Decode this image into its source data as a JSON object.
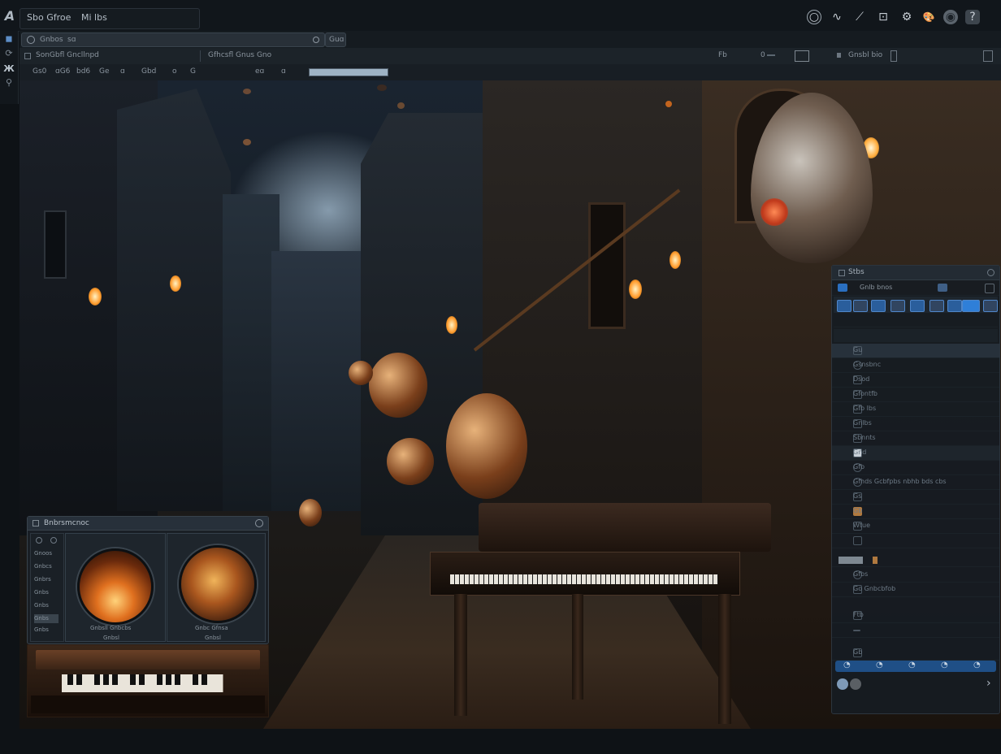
{
  "app": {
    "logo_glyph": "A",
    "title_left": "Sbo Gfroe",
    "title_right": "Mi lbs"
  },
  "topbar_icons": [
    "circle-icon",
    "wave-icon",
    "pen-icon",
    "frame-icon",
    "gear-icon",
    "palette-icon",
    "globe-icon",
    "help-icon"
  ],
  "topbar_glyphs": [
    "○",
    "∿",
    "⟋",
    "⊡",
    "⚙",
    "🎨",
    "◉",
    "?"
  ],
  "rail": {
    "glyphs": [
      "◼",
      "⟳",
      "Ж",
      "⚲"
    ]
  },
  "tabbar": {
    "tab_label": "Gnbos",
    "tab_badge": "sɑ",
    "tab2_label": "Guɑ"
  },
  "toolbar2": {
    "left_label": "SonGbfl Gncllnpd",
    "mid_label": "Gfhcsfl Gnus Gno",
    "right_a": "Fb",
    "right_b": "0",
    "right_c": "Gnsbl bio"
  },
  "toolbar3": {
    "items": [
      "Gs0",
      "ɑG6",
      "bd6",
      "Ge",
      "ɑ",
      "Gbd",
      "o",
      "G",
      "eɑ",
      "ɑ"
    ]
  },
  "right_panel": {
    "title": "Stbs",
    "search_label": "Gnlb bnos",
    "rows": [
      "Gu",
      "Gsnsbnc",
      "Dsod",
      "Gfontfb",
      "Gfb lbs",
      "Gnlbs",
      "Sbnnts",
      "Gnd",
      "Gfb",
      "Gfhds Gcbfpbs nbhb bds cbs",
      "Gs",
      "Gb",
      "Wtue",
      "",
      "Gfbs",
      "Go Gnbcbfob",
      "",
      "Ftb",
      "",
      "Gb"
    ],
    "bottom_bar": [
      "◔",
      "◔",
      "◔",
      "◔",
      "◔"
    ],
    "chevron": "›"
  },
  "instrument_panel": {
    "title": "Bnbrsmcnoc",
    "side_items": [
      "Gnoos",
      "Gnbcs",
      "Gnbrs",
      "Gnbs",
      "Gnbs",
      "Gnbs",
      "Gnbs"
    ],
    "left_caption": "Gnbsll Gnbcbs",
    "right_caption": "Gnbc Gfnsa",
    "left_sub": "Gnbsl",
    "right_sub": "Gnbsl"
  },
  "colors": {
    "accent": "#2a6fc0",
    "panel_bg": "#161c22",
    "warm_glow": "#ffb45a"
  }
}
